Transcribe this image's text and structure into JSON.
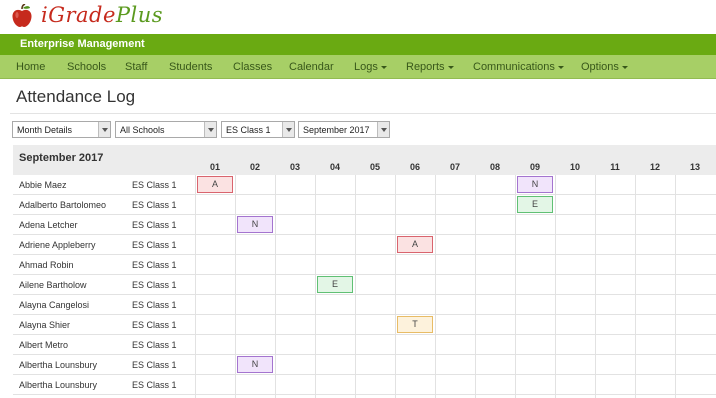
{
  "logo": {
    "part1": "iGrade",
    "part2": "Plus",
    "icon": "apple-icon"
  },
  "header": {
    "enterprise_title": "Enterprise Management"
  },
  "nav": [
    {
      "label": "Home",
      "dropdown": false
    },
    {
      "label": "Schools",
      "dropdown": false
    },
    {
      "label": "Staff",
      "dropdown": false
    },
    {
      "label": "Students",
      "dropdown": false
    },
    {
      "label": "Classes",
      "dropdown": false
    },
    {
      "label": "Calendar",
      "dropdown": false
    },
    {
      "label": "Logs",
      "dropdown": true
    },
    {
      "label": "Reports",
      "dropdown": true
    },
    {
      "label": "Communications",
      "dropdown": true
    },
    {
      "label": "Options",
      "dropdown": true
    }
  ],
  "page_title": "Attendance Log",
  "filters": {
    "view": "Month Details",
    "school": "All Schools",
    "class": "ES Class 1",
    "month": "September 2017"
  },
  "table": {
    "month_label": "September 2017",
    "days": [
      "01",
      "02",
      "03",
      "04",
      "05",
      "06",
      "07",
      "08",
      "09",
      "10",
      "11",
      "12",
      "13"
    ],
    "rows": [
      {
        "name": "Abbie Maez",
        "class": "ES Class 1",
        "marks": [
          {
            "day": "01",
            "code": "A"
          },
          {
            "day": "09",
            "code": "N"
          }
        ]
      },
      {
        "name": "Adalberto Bartolomeo",
        "class": "ES Class 1",
        "marks": [
          {
            "day": "09",
            "code": "E"
          }
        ]
      },
      {
        "name": "Adena Letcher",
        "class": "ES Class 1",
        "marks": [
          {
            "day": "02",
            "code": "N"
          }
        ]
      },
      {
        "name": "Adriene Appleberry",
        "class": "ES Class 1",
        "marks": [
          {
            "day": "06",
            "code": "A"
          }
        ]
      },
      {
        "name": "Ahmad Robin",
        "class": "ES Class 1",
        "marks": []
      },
      {
        "name": "Ailene Bartholow",
        "class": "ES Class 1",
        "marks": [
          {
            "day": "04",
            "code": "E"
          }
        ]
      },
      {
        "name": "Alayna Cangelosi",
        "class": "ES Class 1",
        "marks": []
      },
      {
        "name": "Alayna Shier",
        "class": "ES Class 1",
        "marks": [
          {
            "day": "06",
            "code": "T"
          }
        ]
      },
      {
        "name": "Albert Metro",
        "class": "ES Class 1",
        "marks": []
      },
      {
        "name": "Albertha Lounsbury",
        "class": "ES Class 1",
        "marks": [
          {
            "day": "02",
            "code": "N"
          }
        ]
      },
      {
        "name": "Albertha Lounsbury",
        "class": "ES Class 1",
        "marks": []
      }
    ]
  },
  "colors": {
    "enterprise_bar": "#6aaa12",
    "nav_bar": "#a7cf66",
    "absent": "#d9646e",
    "note": "#a474cf",
    "excused": "#60c074",
    "tardy": "#e8bc66"
  }
}
